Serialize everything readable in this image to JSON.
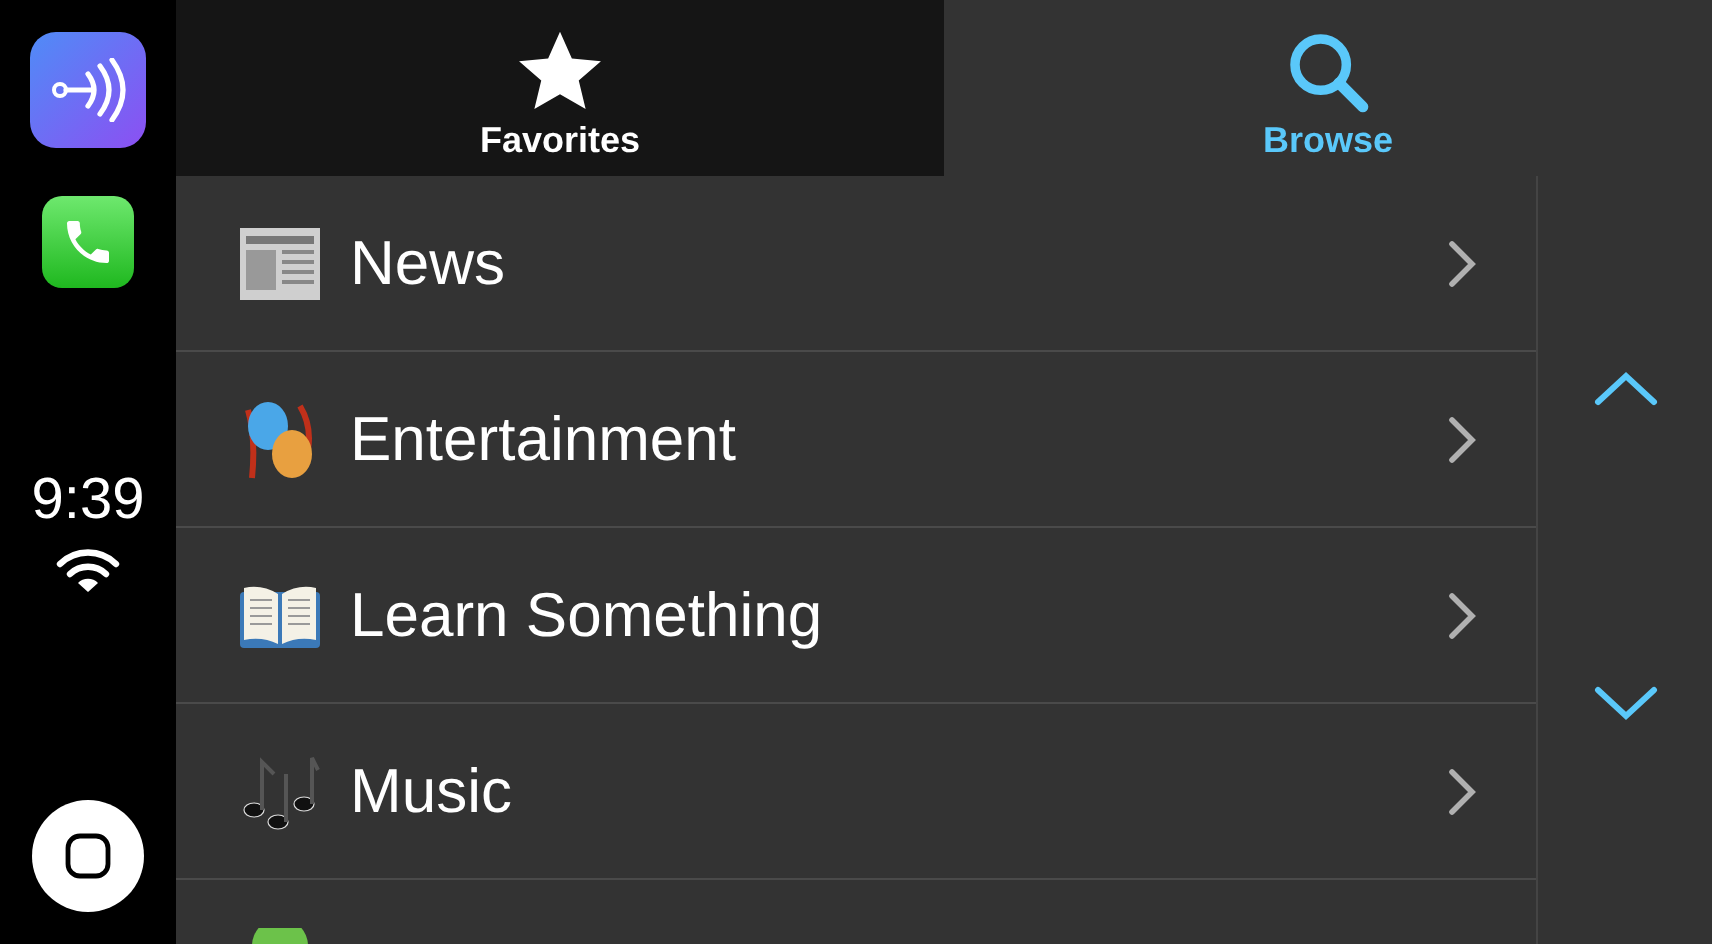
{
  "sidebar": {
    "time": "9:39"
  },
  "tabs": [
    {
      "label": "Favorites",
      "kind": "star",
      "selected": false
    },
    {
      "label": "Browse",
      "kind": "search",
      "selected": true
    }
  ],
  "items": [
    {
      "label": "News",
      "kind": "newspaper"
    },
    {
      "label": "Entertainment",
      "kind": "masks"
    },
    {
      "label": "Learn Something",
      "kind": "book"
    },
    {
      "label": "Music",
      "kind": "notes"
    },
    {
      "kind": "partial"
    }
  ]
}
